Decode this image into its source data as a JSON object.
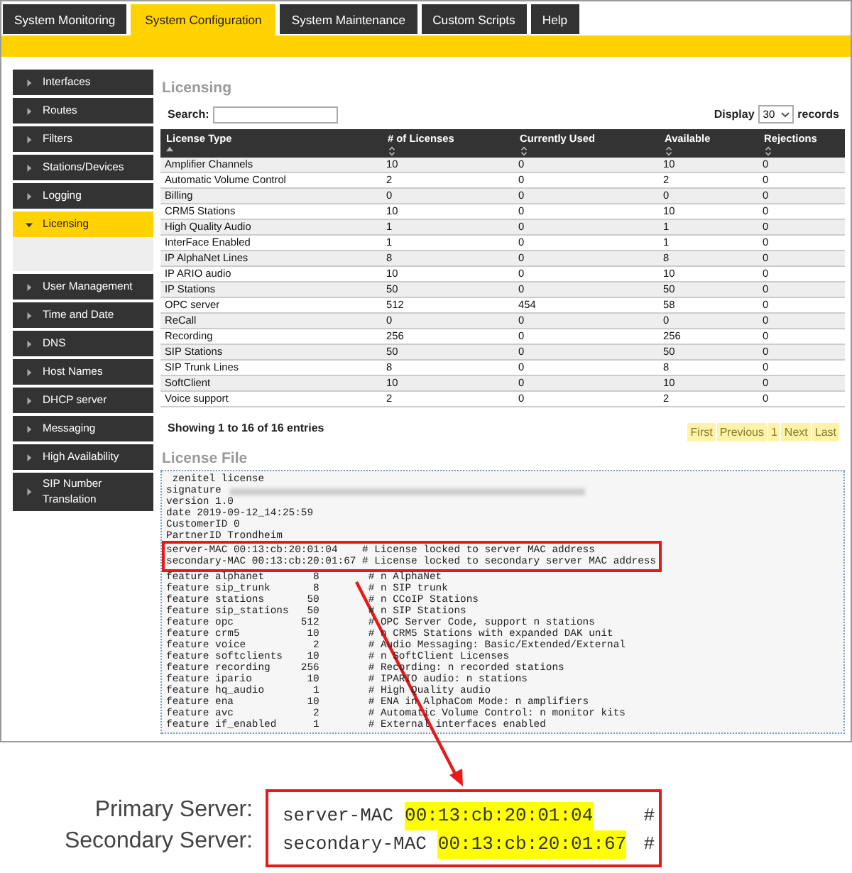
{
  "tabs": [
    {
      "label": "System Monitoring",
      "selected": false
    },
    {
      "label": "System Configuration",
      "selected": true
    },
    {
      "label": "System Maintenance",
      "selected": false
    },
    {
      "label": "Custom Scripts",
      "selected": false
    },
    {
      "label": "Help",
      "selected": false
    }
  ],
  "sidebar": {
    "items": [
      {
        "label": "Interfaces",
        "selected": false,
        "expanded": false
      },
      {
        "label": "Routes",
        "selected": false,
        "expanded": false
      },
      {
        "label": "Filters",
        "selected": false,
        "expanded": false
      },
      {
        "label": "Stations/Devices",
        "selected": false,
        "expanded": false
      },
      {
        "label": "Logging",
        "selected": false,
        "expanded": false
      },
      {
        "label": "Licensing",
        "selected": true,
        "expanded": true
      },
      {
        "label": "User Management",
        "selected": false,
        "expanded": false
      },
      {
        "label": "Time and Date",
        "selected": false,
        "expanded": false
      },
      {
        "label": "DNS",
        "selected": false,
        "expanded": false
      },
      {
        "label": "Host Names",
        "selected": false,
        "expanded": false
      },
      {
        "label": "DHCP server",
        "selected": false,
        "expanded": false
      },
      {
        "label": "Messaging",
        "selected": false,
        "expanded": false
      },
      {
        "label": "High Availability",
        "selected": false,
        "expanded": false
      },
      {
        "label": "SIP Number Translation",
        "selected": false,
        "expanded": false
      }
    ]
  },
  "heading": "Licensing",
  "search": {
    "label": "Search:"
  },
  "display": {
    "label_before": "Display",
    "value": "30",
    "label_after": "records"
  },
  "table": {
    "columns": [
      {
        "label": "License Type",
        "sorted": true
      },
      {
        "label": "# of Licenses",
        "sorted": false
      },
      {
        "label": "Currently Used",
        "sorted": false
      },
      {
        "label": "Available",
        "sorted": false
      },
      {
        "label": "Rejections",
        "sorted": false
      }
    ],
    "rows": [
      [
        "Amplifier Channels",
        "10",
        "0",
        "10",
        "0"
      ],
      [
        "Automatic Volume Control",
        "2",
        "0",
        "2",
        "0"
      ],
      [
        "Billing",
        "0",
        "0",
        "0",
        "0"
      ],
      [
        "CRM5 Stations",
        "10",
        "0",
        "10",
        "0"
      ],
      [
        "High Quality Audio",
        "1",
        "0",
        "1",
        "0"
      ],
      [
        "InterFace Enabled",
        "1",
        "0",
        "1",
        "0"
      ],
      [
        "IP AlphaNet Lines",
        "8",
        "0",
        "8",
        "0"
      ],
      [
        "IP ARIO audio",
        "10",
        "0",
        "10",
        "0"
      ],
      [
        "IP Stations",
        "50",
        "0",
        "50",
        "0"
      ],
      [
        "OPC server",
        "512",
        "454",
        "58",
        "0"
      ],
      [
        "ReCall",
        "0",
        "0",
        "0",
        "0"
      ],
      [
        "Recording",
        "256",
        "0",
        "256",
        "0"
      ],
      [
        "SIP Stations",
        "50",
        "0",
        "50",
        "0"
      ],
      [
        "SIP Trunk Lines",
        "8",
        "0",
        "8",
        "0"
      ],
      [
        "SoftClient",
        "10",
        "0",
        "10",
        "0"
      ],
      [
        "Voice support",
        "2",
        "0",
        "2",
        "0"
      ]
    ]
  },
  "info": "Showing 1 to 16 of 16 entries",
  "pagination": [
    "First",
    "Previous",
    "1",
    "Next",
    "Last"
  ],
  "license_file": {
    "heading": "License File",
    "lines": [
      {
        "text": " zenitel license",
        "redacted": false,
        "highlighted": false
      },
      {
        "text": "signature",
        "redacted": true,
        "highlighted": false
      },
      {
        "text": "version 1.0",
        "redacted": false,
        "highlighted": false
      },
      {
        "text": "date 2019-09-12_14:25:59",
        "redacted": false,
        "highlighted": false
      },
      {
        "text": "CustomerID 0",
        "redacted": false,
        "highlighted": false
      },
      {
        "text": "PartnerID Trondheim",
        "redacted": false,
        "highlighted": false
      },
      {
        "text": "server-MAC 00:13:cb:20:01:04    # License locked to server MAC address",
        "redacted": false,
        "highlighted": true
      },
      {
        "text": "secondary-MAC 00:13:cb:20:01:67 # License locked to secondary server MAC address",
        "redacted": false,
        "highlighted": true
      },
      {
        "text": "feature alphanet        8        # n AlphaNet",
        "redacted": false,
        "highlighted": false
      },
      {
        "text": "feature sip_trunk       8        # n SIP trunk",
        "redacted": false,
        "highlighted": false
      },
      {
        "text": "feature stations       50        # n CCoIP Stations",
        "redacted": false,
        "highlighted": false
      },
      {
        "text": "feature sip_stations   50        # n SIP Stations",
        "redacted": false,
        "highlighted": false
      },
      {
        "text": "feature opc           512        # OPC Server Code, support n stations",
        "redacted": false,
        "highlighted": false
      },
      {
        "text": "feature crm5           10        # n CRM5 Stations with expanded DAK unit",
        "redacted": false,
        "highlighted": false
      },
      {
        "text": "feature voice           2        # Audio Messaging: Basic/Extended/External",
        "redacted": false,
        "highlighted": false
      },
      {
        "text": "feature softclients    10        # n SoftClient Licenses",
        "redacted": false,
        "highlighted": false
      },
      {
        "text": "feature recording     256        # Recording: n recorded stations",
        "redacted": false,
        "highlighted": false
      },
      {
        "text": "feature ipario         10        # IPARIO audio: n stations",
        "redacted": false,
        "highlighted": false
      },
      {
        "text": "feature hq_audio        1        # High Quality audio",
        "redacted": false,
        "highlighted": false
      },
      {
        "text": "feature ena            10        # ENA in AlphaCom Mode: n amplifiers",
        "redacted": false,
        "highlighted": false
      },
      {
        "text": "feature avc             2        # Automatic Volume Control: n monitor kits",
        "redacted": false,
        "highlighted": false
      },
      {
        "text": "feature if_enabled      1        # External interfaces enabled",
        "redacted": false,
        "highlighted": false
      }
    ]
  },
  "callout": {
    "rows": [
      {
        "label": "Primary Server:",
        "key": "server-MAC",
        "value": "00:13:cb:20:01:04",
        "hash": "#"
      },
      {
        "label": "Secondary Server:",
        "key": "secondary-MAC",
        "value": "00:13:cb:20:01:67",
        "hash": "#"
      }
    ]
  }
}
